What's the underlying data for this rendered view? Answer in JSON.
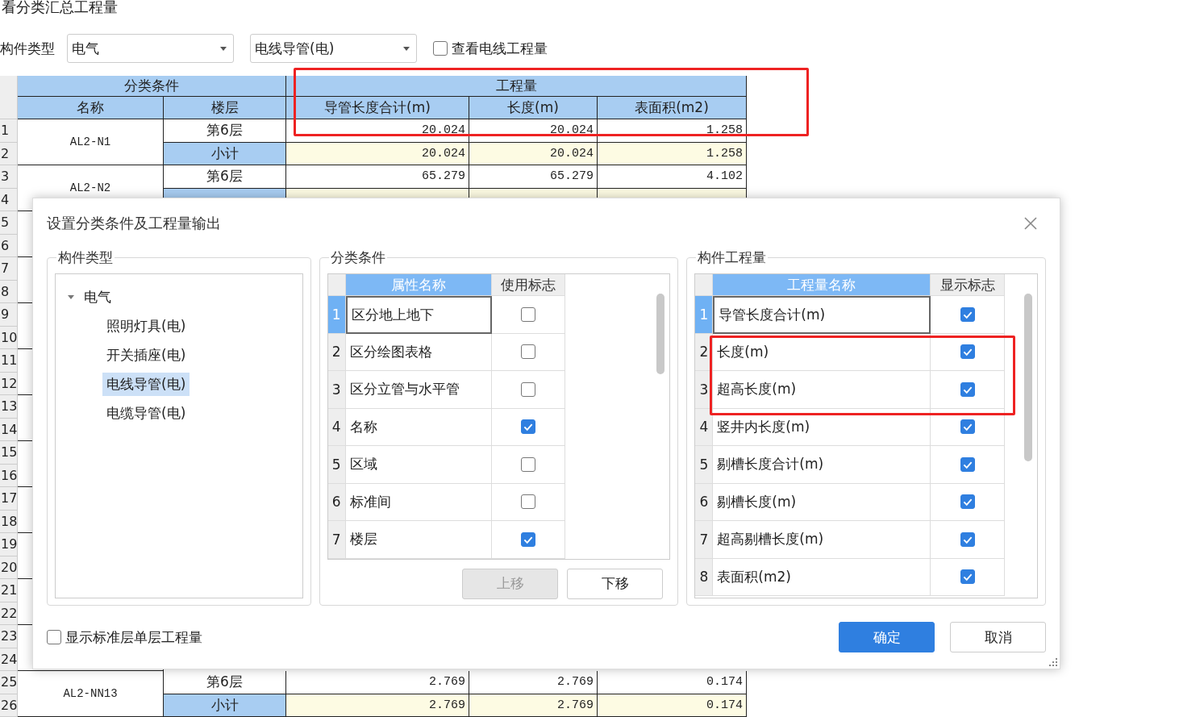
{
  "window": {
    "title": "看分类汇总工程量"
  },
  "filter": {
    "label": "构件类型",
    "dropdowns": [
      {
        "value": "电气"
      },
      {
        "value": "电线导管(电)"
      }
    ],
    "checkbox": {
      "label": "查看电线工程量",
      "checked": false
    }
  },
  "table": {
    "classification_header": "分类条件",
    "quantity_header": "工程量",
    "columns": [
      "名称",
      "楼层",
      "导管长度合计(m)",
      "长度(m)",
      "表面积(m2)"
    ],
    "groups": [
      {
        "name": "AL2-N1",
        "rows": [
          {
            "number": "1",
            "kind": "detail",
            "floor": "第6层",
            "values": [
              "20.024",
              "20.024",
              "1.258"
            ]
          },
          {
            "number": "2",
            "kind": "subtotal",
            "floor": "小计",
            "values": [
              "20.024",
              "20.024",
              "1.258"
            ]
          }
        ]
      },
      {
        "name": "AL2-N2",
        "rows": [
          {
            "number": "3",
            "kind": "detail",
            "floor": "第6层",
            "values": [
              "65.279",
              "65.279",
              "4.102"
            ]
          },
          {
            "number": "4",
            "kind": "subtotal"
          }
        ]
      },
      {
        "rows": [
          {
            "number": "5"
          },
          {
            "number": "6"
          }
        ]
      },
      {
        "rows": [
          {
            "number": "7"
          },
          {
            "number": "8"
          }
        ]
      },
      {
        "rows": [
          {
            "number": "9"
          },
          {
            "number": "10"
          }
        ]
      },
      {
        "rows": [
          {
            "number": "11"
          },
          {
            "number": "12"
          }
        ]
      },
      {
        "rows": [
          {
            "number": "13"
          },
          {
            "number": "14"
          }
        ]
      },
      {
        "rows": [
          {
            "number": "15"
          },
          {
            "number": "16"
          }
        ]
      },
      {
        "rows": [
          {
            "number": "17"
          },
          {
            "number": "18"
          }
        ]
      },
      {
        "rows": [
          {
            "number": "19"
          },
          {
            "number": "20"
          }
        ]
      },
      {
        "rows": [
          {
            "number": "21"
          },
          {
            "number": "22"
          }
        ]
      },
      {
        "rows": [
          {
            "number": "23"
          },
          {
            "number": "24"
          }
        ]
      },
      {
        "name": "AL2-NN13",
        "rows": [
          {
            "number": "25",
            "kind": "detail",
            "floor": "第6层",
            "values": [
              "2.769",
              "2.769",
              "0.174"
            ]
          },
          {
            "number": "26",
            "kind": "subtotal",
            "floor": "小计",
            "values": [
              "2.769",
              "2.769",
              "0.174"
            ]
          }
        ]
      }
    ]
  },
  "dialog": {
    "title": "设置分类条件及工程量输出",
    "component_types": {
      "title": "构件类型",
      "tree": [
        {
          "label": "电气",
          "expanded": true,
          "selected": false,
          "children": [
            {
              "label": "照明灯具(电)",
              "selected": false
            },
            {
              "label": "开关插座(电)",
              "selected": false
            },
            {
              "label": "电线导管(电)",
              "selected": true
            },
            {
              "label": "电缆导管(电)",
              "selected": false
            }
          ]
        }
      ]
    },
    "conditions": {
      "title": "分类条件",
      "columns": [
        {
          "label": "属性名称",
          "selected": true
        },
        {
          "label": "使用标志",
          "selected": false
        }
      ],
      "rows": [
        {
          "number": "1",
          "name": "区分地上地下",
          "checked": false,
          "selected": true
        },
        {
          "number": "2",
          "name": "区分绘图表格",
          "checked": false,
          "selected": false
        },
        {
          "number": "3",
          "name": "区分立管与水平管",
          "checked": false,
          "selected": false
        },
        {
          "number": "4",
          "name": "名称",
          "checked": true,
          "selected": false
        },
        {
          "number": "5",
          "name": "区域",
          "checked": false,
          "selected": false
        },
        {
          "number": "6",
          "name": "标准间",
          "checked": false,
          "selected": false
        },
        {
          "number": "7",
          "name": "楼层",
          "checked": true,
          "selected": false
        }
      ],
      "buttons": [
        {
          "label": "上移",
          "disabled": true
        },
        {
          "label": "下移",
          "disabled": false
        }
      ]
    },
    "quantities": {
      "title": "构件工程量",
      "columns": [
        {
          "label": "工程量名称",
          "selected": true
        },
        {
          "label": "显示标志",
          "selected": false
        }
      ],
      "rows": [
        {
          "number": "1",
          "name": "导管长度合计(m)",
          "checked": true,
          "selected": true
        },
        {
          "number": "2",
          "name": "长度(m)",
          "checked": true,
          "selected": false
        },
        {
          "number": "3",
          "name": "超高长度(m)",
          "checked": true,
          "selected": false
        },
        {
          "number": "4",
          "name": "竖井内长度(m)",
          "checked": true,
          "selected": false
        },
        {
          "number": "5",
          "name": "剔槽长度合计(m)",
          "checked": true,
          "selected": false
        },
        {
          "number": "6",
          "name": "剔槽长度(m)",
          "checked": true,
          "selected": false
        },
        {
          "number": "7",
          "name": "超高剔槽长度(m)",
          "checked": true,
          "selected": false
        },
        {
          "number": "8",
          "name": "表面积(m2)",
          "checked": true,
          "selected": false
        }
      ]
    },
    "standard_floor_checkbox": {
      "label": "显示标准层单层工程量",
      "checked": false
    },
    "buttons": [
      {
        "label": "确定",
        "kind": "primary"
      },
      {
        "label": "取消",
        "kind": "secondary"
      }
    ]
  }
}
